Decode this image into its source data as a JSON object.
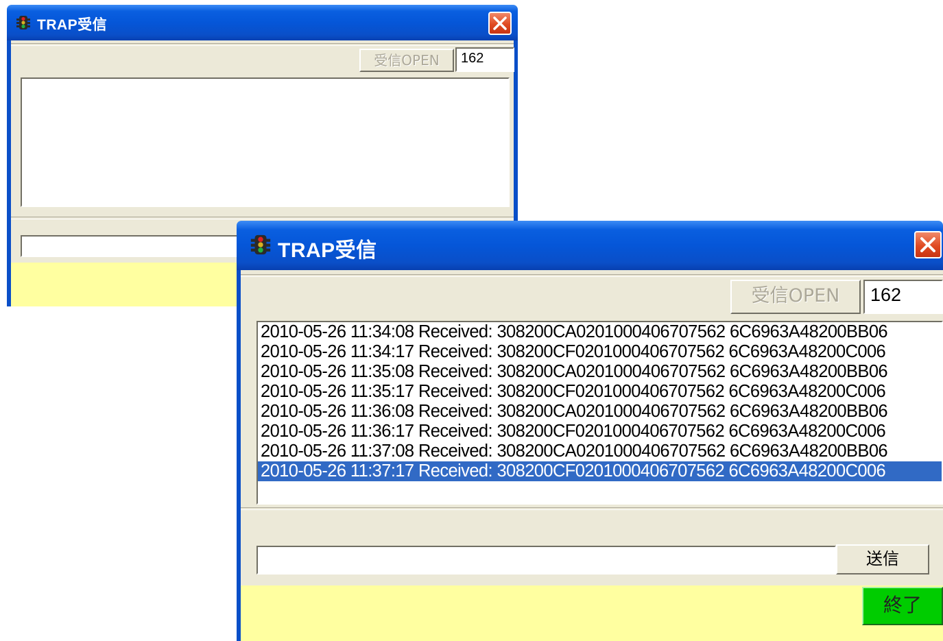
{
  "windows": [
    {
      "title": "TRAP受信",
      "receive_open_label": "受信OPEN",
      "port": "162",
      "log": [],
      "message_input": ""
    },
    {
      "title": "TRAP受信",
      "receive_open_label": "受信OPEN",
      "port": "162",
      "log": [
        "2010-05-26 11:34:08  Received: 308200CA0201000406707562 6C6963A48200BB06",
        "2010-05-26 11:34:17  Received: 308200CF0201000406707562 6C6963A48200C006",
        "2010-05-26 11:35:08  Received: 308200CA0201000406707562 6C6963A48200BB06",
        "2010-05-26 11:35:17  Received: 308200CF0201000406707562 6C6963A48200C006",
        "2010-05-26 11:36:08  Received: 308200CA0201000406707562 6C6963A48200BB06",
        "2010-05-26 11:36:17  Received: 308200CF0201000406707562 6C6963A48200C006",
        "2010-05-26 11:37:08  Received: 308200CA0201000406707562 6C6963A48200BB06",
        "2010-05-26 11:37:17  Received: 308200CF0201000406707562 6C6963A48200C006"
      ],
      "selected_log_index": 7,
      "message_input": "",
      "send_label": "送信",
      "exit_label": "終了"
    }
  ],
  "colors": {
    "titlebar": "#0556d8",
    "status_bar": "#ffffa0",
    "selection": "#316ac5",
    "exit_button": "#00cc00"
  },
  "icons": {
    "app": "traffic-light-icon",
    "close": "close-icon"
  }
}
